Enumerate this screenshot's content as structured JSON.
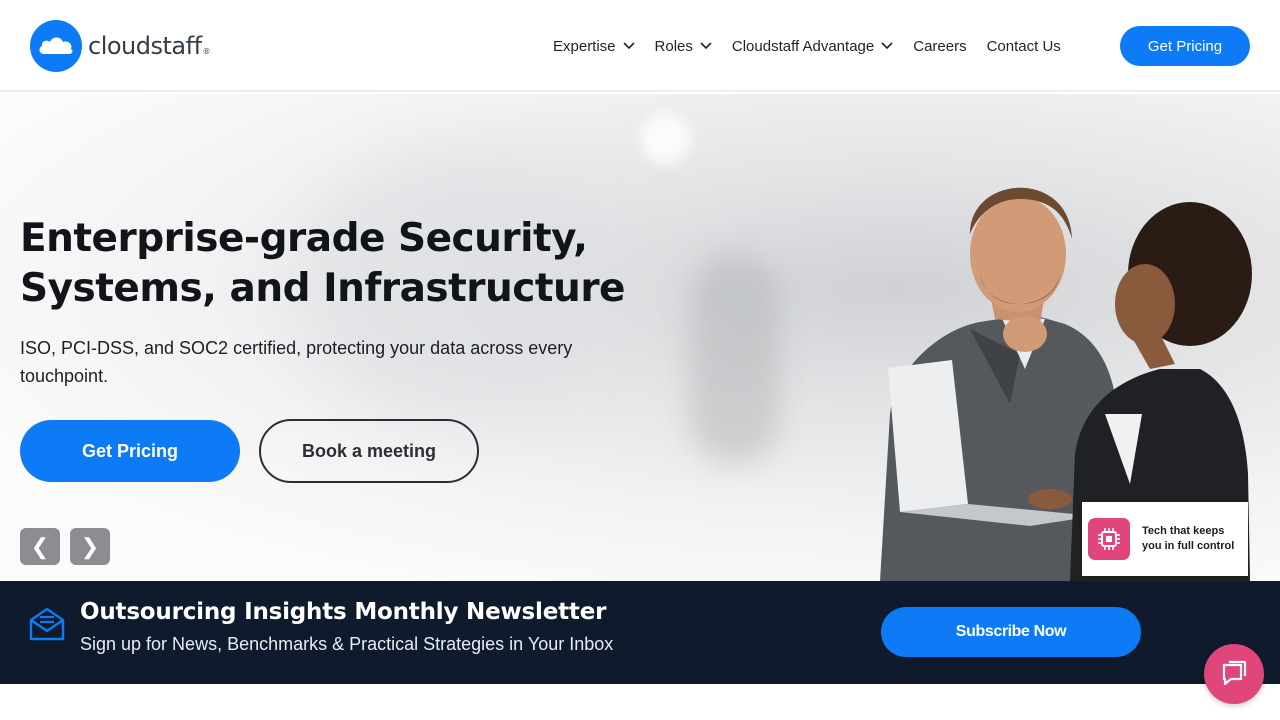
{
  "header": {
    "logo_text": "cloudstaff",
    "logo_mark": "®",
    "nav": [
      {
        "label": "Expertise",
        "has_dropdown": true
      },
      {
        "label": "Roles",
        "has_dropdown": true
      },
      {
        "label": "Cloudstaff Advantage",
        "has_dropdown": true
      },
      {
        "label": "Careers",
        "has_dropdown": false
      },
      {
        "label": "Contact Us",
        "has_dropdown": false
      }
    ],
    "cta_label": "Get Pricing"
  },
  "hero": {
    "title_line1": "Enterprise-grade Security,",
    "title_line2": "Systems, and Infrastructure",
    "subtitle": "ISO, PCI-DSS, and SOC2 certified, protecting your data across every touchpoint.",
    "primary_button": "Get Pricing",
    "secondary_button": "Book a meeting",
    "prev_arrow": "❮",
    "next_arrow": "❯",
    "badge_text": "Tech that keeps you in full control"
  },
  "newsletter": {
    "title": "Outsourcing Insights Monthly Newsletter",
    "subtitle": "Sign up for News, Benchmarks & Practical Strategies in Your Inbox",
    "button_label": "Subscribe Now"
  },
  "icons": {
    "logo": "cloud-icon",
    "nav_dropdown": "chevron-down-icon",
    "newsletter": "mail-icon",
    "badge": "chip-icon",
    "chat": "chat-icon"
  },
  "colors": {
    "brand_blue": "#0d7bf5",
    "navy": "#0f1b2d",
    "accent_pink": "#e0457b",
    "text_dark": "#111418"
  }
}
